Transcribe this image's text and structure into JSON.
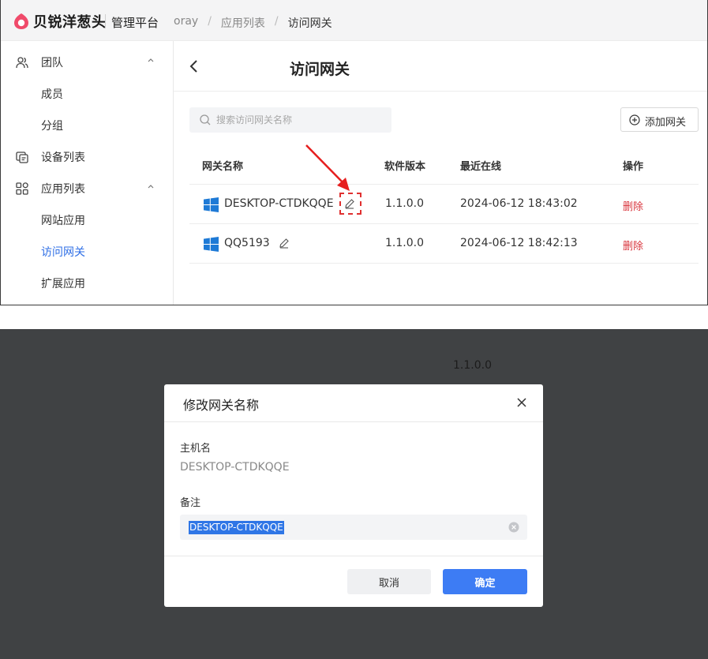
{
  "header": {
    "brand": "贝锐洋葱头",
    "platform": "管理平台",
    "breadcrumb": [
      "oray",
      "应用列表",
      "访问网关"
    ]
  },
  "sidebar": {
    "items": [
      {
        "label": "团队",
        "icon": "team-icon",
        "expanded": true
      },
      {
        "label": "成员"
      },
      {
        "label": "分组"
      },
      {
        "label": "设备列表",
        "icon": "device-list-icon"
      },
      {
        "label": "应用列表",
        "icon": "app-grid-icon",
        "expanded": true
      },
      {
        "label": "网站应用"
      },
      {
        "label": "访问网关",
        "active": true
      },
      {
        "label": "扩展应用"
      }
    ]
  },
  "main": {
    "title": "访问网关",
    "search_placeholder": "搜索访问网关名称",
    "add_button": "添加网关",
    "columns": [
      "网关名称",
      "软件版本",
      "最近在线",
      "操作"
    ],
    "rows": [
      {
        "name": "DESKTOP-CTDKQQE",
        "version": "1.1.0.0",
        "last_online": "2024-06-12 18:43:02",
        "action": "删除",
        "os_icon": "windows-icon"
      },
      {
        "name": "QQ5193",
        "version": "1.1.0.0",
        "last_online": "2024-06-12 18:42:13",
        "action": "删除",
        "os_icon": "windows-icon"
      }
    ]
  },
  "background": {
    "partial_text": "1.1.0.0"
  },
  "dialog": {
    "title": "修改网关名称",
    "host_label": "主机名",
    "host_value": "DESKTOP-CTDKQQE",
    "note_label": "备注",
    "note_value": "DESKTOP-CTDKQQE",
    "cancel": "取消",
    "confirm": "确定"
  },
  "colors": {
    "accent": "#3d7cf4",
    "danger": "#d9363e",
    "active_nav": "#2f6fe6",
    "annotation": "#e03030",
    "overlay": "#404244"
  }
}
